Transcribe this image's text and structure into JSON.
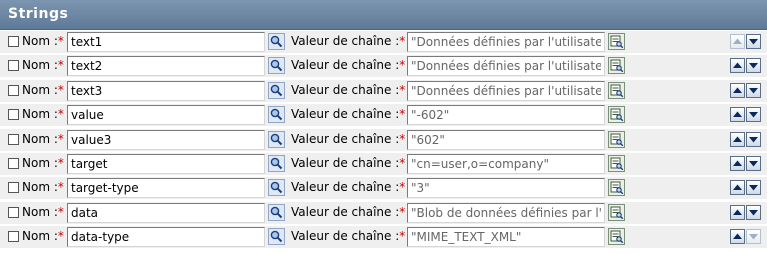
{
  "panel": {
    "title": "Strings"
  },
  "labels": {
    "name": "Nom :",
    "value": "Valeur de chaîne :",
    "required_mark": "*"
  },
  "rows": [
    {
      "name": "text1",
      "value": "\"Données définies par l'utilisateur\"",
      "up_enabled": false,
      "down_enabled": true
    },
    {
      "name": "text2",
      "value": "\"Données définies par l'utilisateur\"",
      "up_enabled": true,
      "down_enabled": true
    },
    {
      "name": "text3",
      "value": "\"Données définies par l'utilisateur\"",
      "up_enabled": true,
      "down_enabled": true
    },
    {
      "name": "value",
      "value": "\"-602\"",
      "up_enabled": true,
      "down_enabled": true
    },
    {
      "name": "value3",
      "value": "\"602\"",
      "up_enabled": true,
      "down_enabled": true
    },
    {
      "name": "target",
      "value": "\"cn=user,o=company\"",
      "up_enabled": true,
      "down_enabled": true
    },
    {
      "name": "target-type",
      "value": "\"3\"",
      "up_enabled": true,
      "down_enabled": true
    },
    {
      "name": "data",
      "value": "\"Blob de données définies par l'utilisateur\"",
      "up_enabled": true,
      "down_enabled": true
    },
    {
      "name": "data-type",
      "value": "\"MIME_TEXT_XML\"",
      "up_enabled": true,
      "down_enabled": false
    }
  ],
  "icons": {
    "checkbox": "checkbox-icon",
    "search": "magnifier-icon",
    "editor": "expression-editor-icon",
    "up": "arrow-up-icon",
    "down": "arrow-down-icon"
  },
  "colors": {
    "header_bg": "#6b85a3",
    "row_bg": "#efefef",
    "required": "#cc0000"
  }
}
